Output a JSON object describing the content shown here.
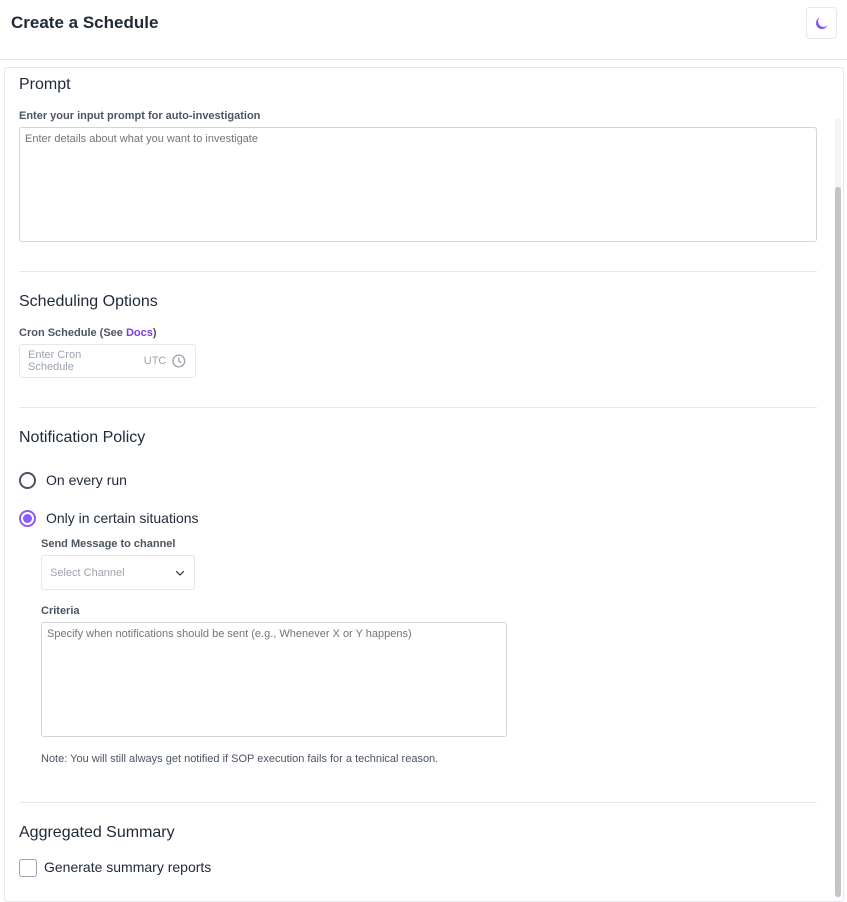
{
  "header": {
    "title": "Create a Schedule",
    "theme_icon": "moon-icon"
  },
  "prompt_section": {
    "title": "Prompt",
    "label": "Enter your input prompt for auto-investigation",
    "placeholder": "Enter details about what you want to investigate",
    "value": ""
  },
  "scheduling": {
    "title": "Scheduling Options",
    "label_prefix": "Cron Schedule (See ",
    "docs_link": "Docs",
    "label_suffix": ")",
    "placeholder": "Enter Cron Schedule",
    "timezone": "UTC",
    "clock_icon": "clock-icon"
  },
  "notification": {
    "title": "Notification Policy",
    "options": [
      {
        "label": "On every run",
        "selected": false
      },
      {
        "label": "Only in certain situations",
        "selected": true
      }
    ],
    "channel_label": "Send Message to channel",
    "channel_placeholder": "Select Channel",
    "criteria_label": "Criteria",
    "criteria_placeholder": "Specify when notifications should be sent (e.g., Whenever X or Y happens)",
    "note": "Note: You will still always get notified if SOP execution fails for a technical reason."
  },
  "summary": {
    "title": "Aggregated Summary",
    "checkbox_label": "Generate summary reports",
    "checked": false
  },
  "colors": {
    "accent": "#8b5cf6",
    "border": "#e5e7eb",
    "text": "#1f2937",
    "muted": "#9ca3af"
  }
}
